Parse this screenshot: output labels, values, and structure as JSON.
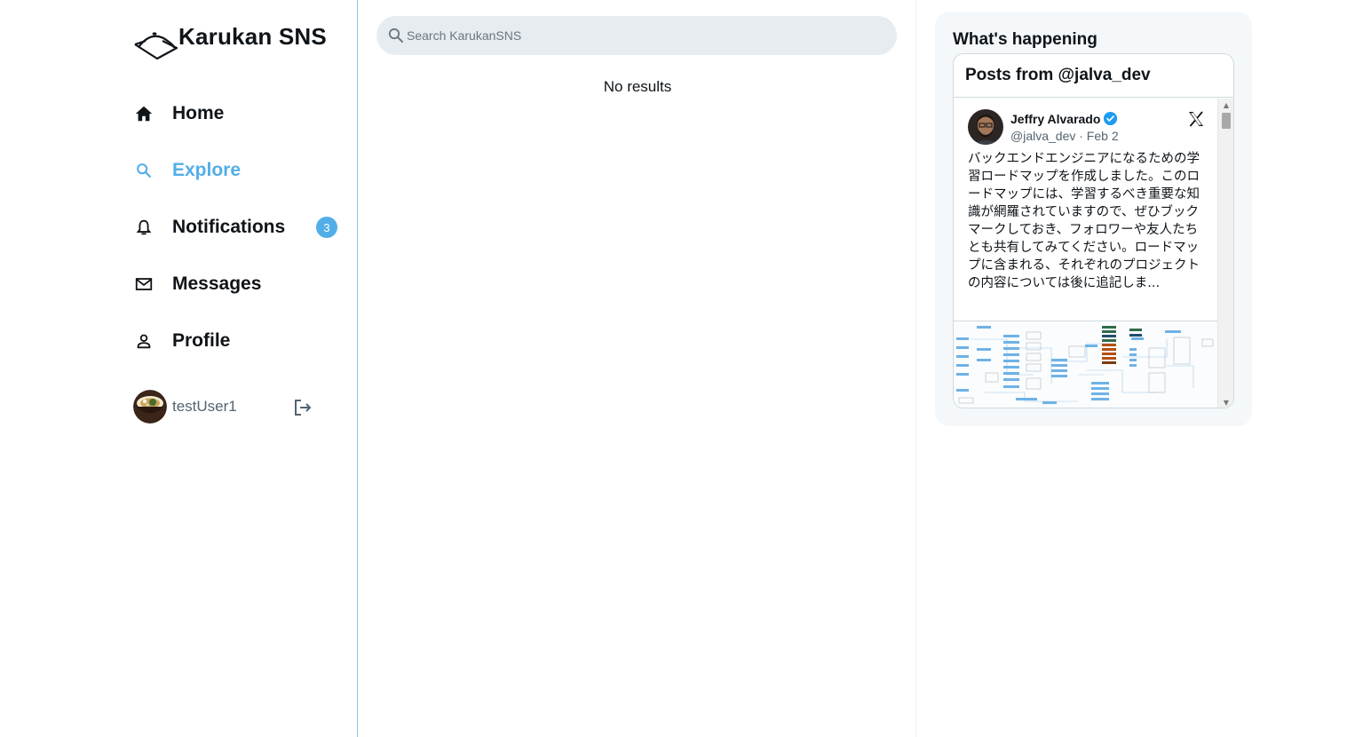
{
  "brand": {
    "name": "Karukan SNS"
  },
  "nav": {
    "items": [
      {
        "label": "Home",
        "icon": "home-icon"
      },
      {
        "label": "Explore",
        "icon": "search-icon"
      },
      {
        "label": "Notifications",
        "icon": "bell-icon",
        "badge": "3"
      },
      {
        "label": "Messages",
        "icon": "mail-icon"
      },
      {
        "label": "Profile",
        "icon": "person-icon"
      }
    ],
    "active": "Explore"
  },
  "user": {
    "name": "testUser1"
  },
  "search": {
    "placeholder": "Search KarukanSNS",
    "value": ""
  },
  "main": {
    "empty_text": "No results"
  },
  "sidebar_right": {
    "title": "What's happening",
    "embed": {
      "header": "Posts from @jalva_dev",
      "tweet": {
        "author": "Jeffry Alvarado",
        "meta": "@jalva_dev · Feb 2",
        "text": "バックエンドエンジニアになるための学習ロードマップを作成しました。このロードマップには、学習するべき重要な知識が網羅されていますので、ぜひブックマークしておき、フォロワーや友人たちとも共有してみてください。ロードマップに含まれる、それぞれのプロジェクトの内容については後に追記しま..."
      }
    }
  },
  "colors": {
    "accent": "#52aee8",
    "text": "#0f1419",
    "muted": "#536471",
    "search_bg": "#e6ecf0"
  }
}
